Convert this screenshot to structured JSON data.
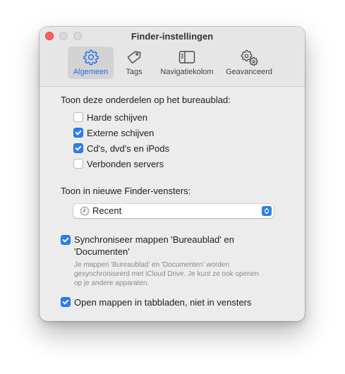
{
  "window": {
    "title": "Finder-instellingen"
  },
  "tabs": [
    {
      "label": "Algemeen",
      "icon": "gear-icon",
      "selected": true
    },
    {
      "label": "Tags",
      "icon": "tag-icon",
      "selected": false
    },
    {
      "label": "Navigatiekolom",
      "icon": "sidebar-icon",
      "selected": false
    },
    {
      "label": "Geavanceerd",
      "icon": "gears-icon",
      "selected": false
    }
  ],
  "desktop": {
    "label": "Toon deze onderdelen op het bureaublad:",
    "items": [
      {
        "label": "Harde schijven",
        "checked": false
      },
      {
        "label": "Externe schijven",
        "checked": true
      },
      {
        "label": "Cd's, dvd's en iPods",
        "checked": true
      },
      {
        "label": "Verbonden servers",
        "checked": false
      }
    ]
  },
  "new_window": {
    "label": "Toon in nieuwe Finder-vensters:",
    "value": "Recent",
    "icon": "clock-icon"
  },
  "sync": {
    "label": "Synchroniseer mappen 'Bureaublad' en 'Documenten'",
    "checked": true,
    "note": "Je mappen 'Bureaublad' en 'Documenten' worden gesynchroniseerd met iCloud Drive. Je kunt ze ook openen op je andere apparaten."
  },
  "tabs_option": {
    "label": "Open mappen in tabbladen, niet in vensters",
    "checked": true
  },
  "colors": {
    "accent": "#2a7ef0",
    "close": "#ff5f57"
  }
}
